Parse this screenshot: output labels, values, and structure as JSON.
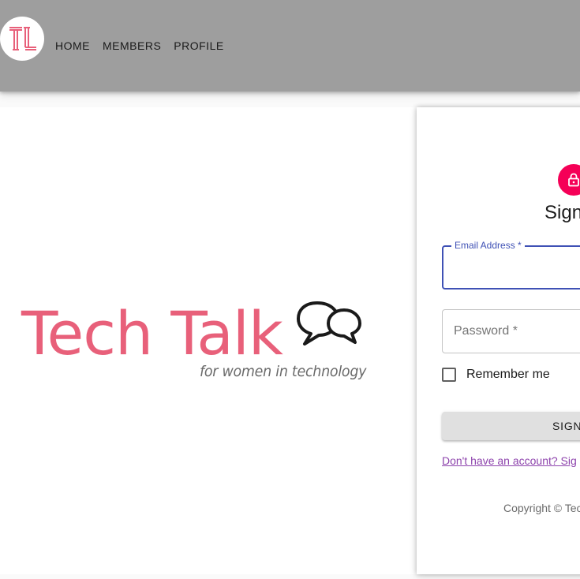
{
  "header": {
    "logo_text": "TL",
    "nav": [
      "HOME",
      "MEMBERS",
      "PROFILE"
    ]
  },
  "hero": {
    "brand_title": "Tech Talk",
    "tagline": "for women in technology",
    "brand_color": "#e8607a"
  },
  "signin": {
    "heading": "Sign",
    "email_label": "Email Address *",
    "password_placeholder": "Password *",
    "remember_label": "Remember me",
    "button_label": "SIGN",
    "signup_link": "Don't have an account? Sig",
    "copyright": "Copyright © Tec",
    "accent_color": "#3f51b5",
    "avatar_color": "#f50057"
  }
}
